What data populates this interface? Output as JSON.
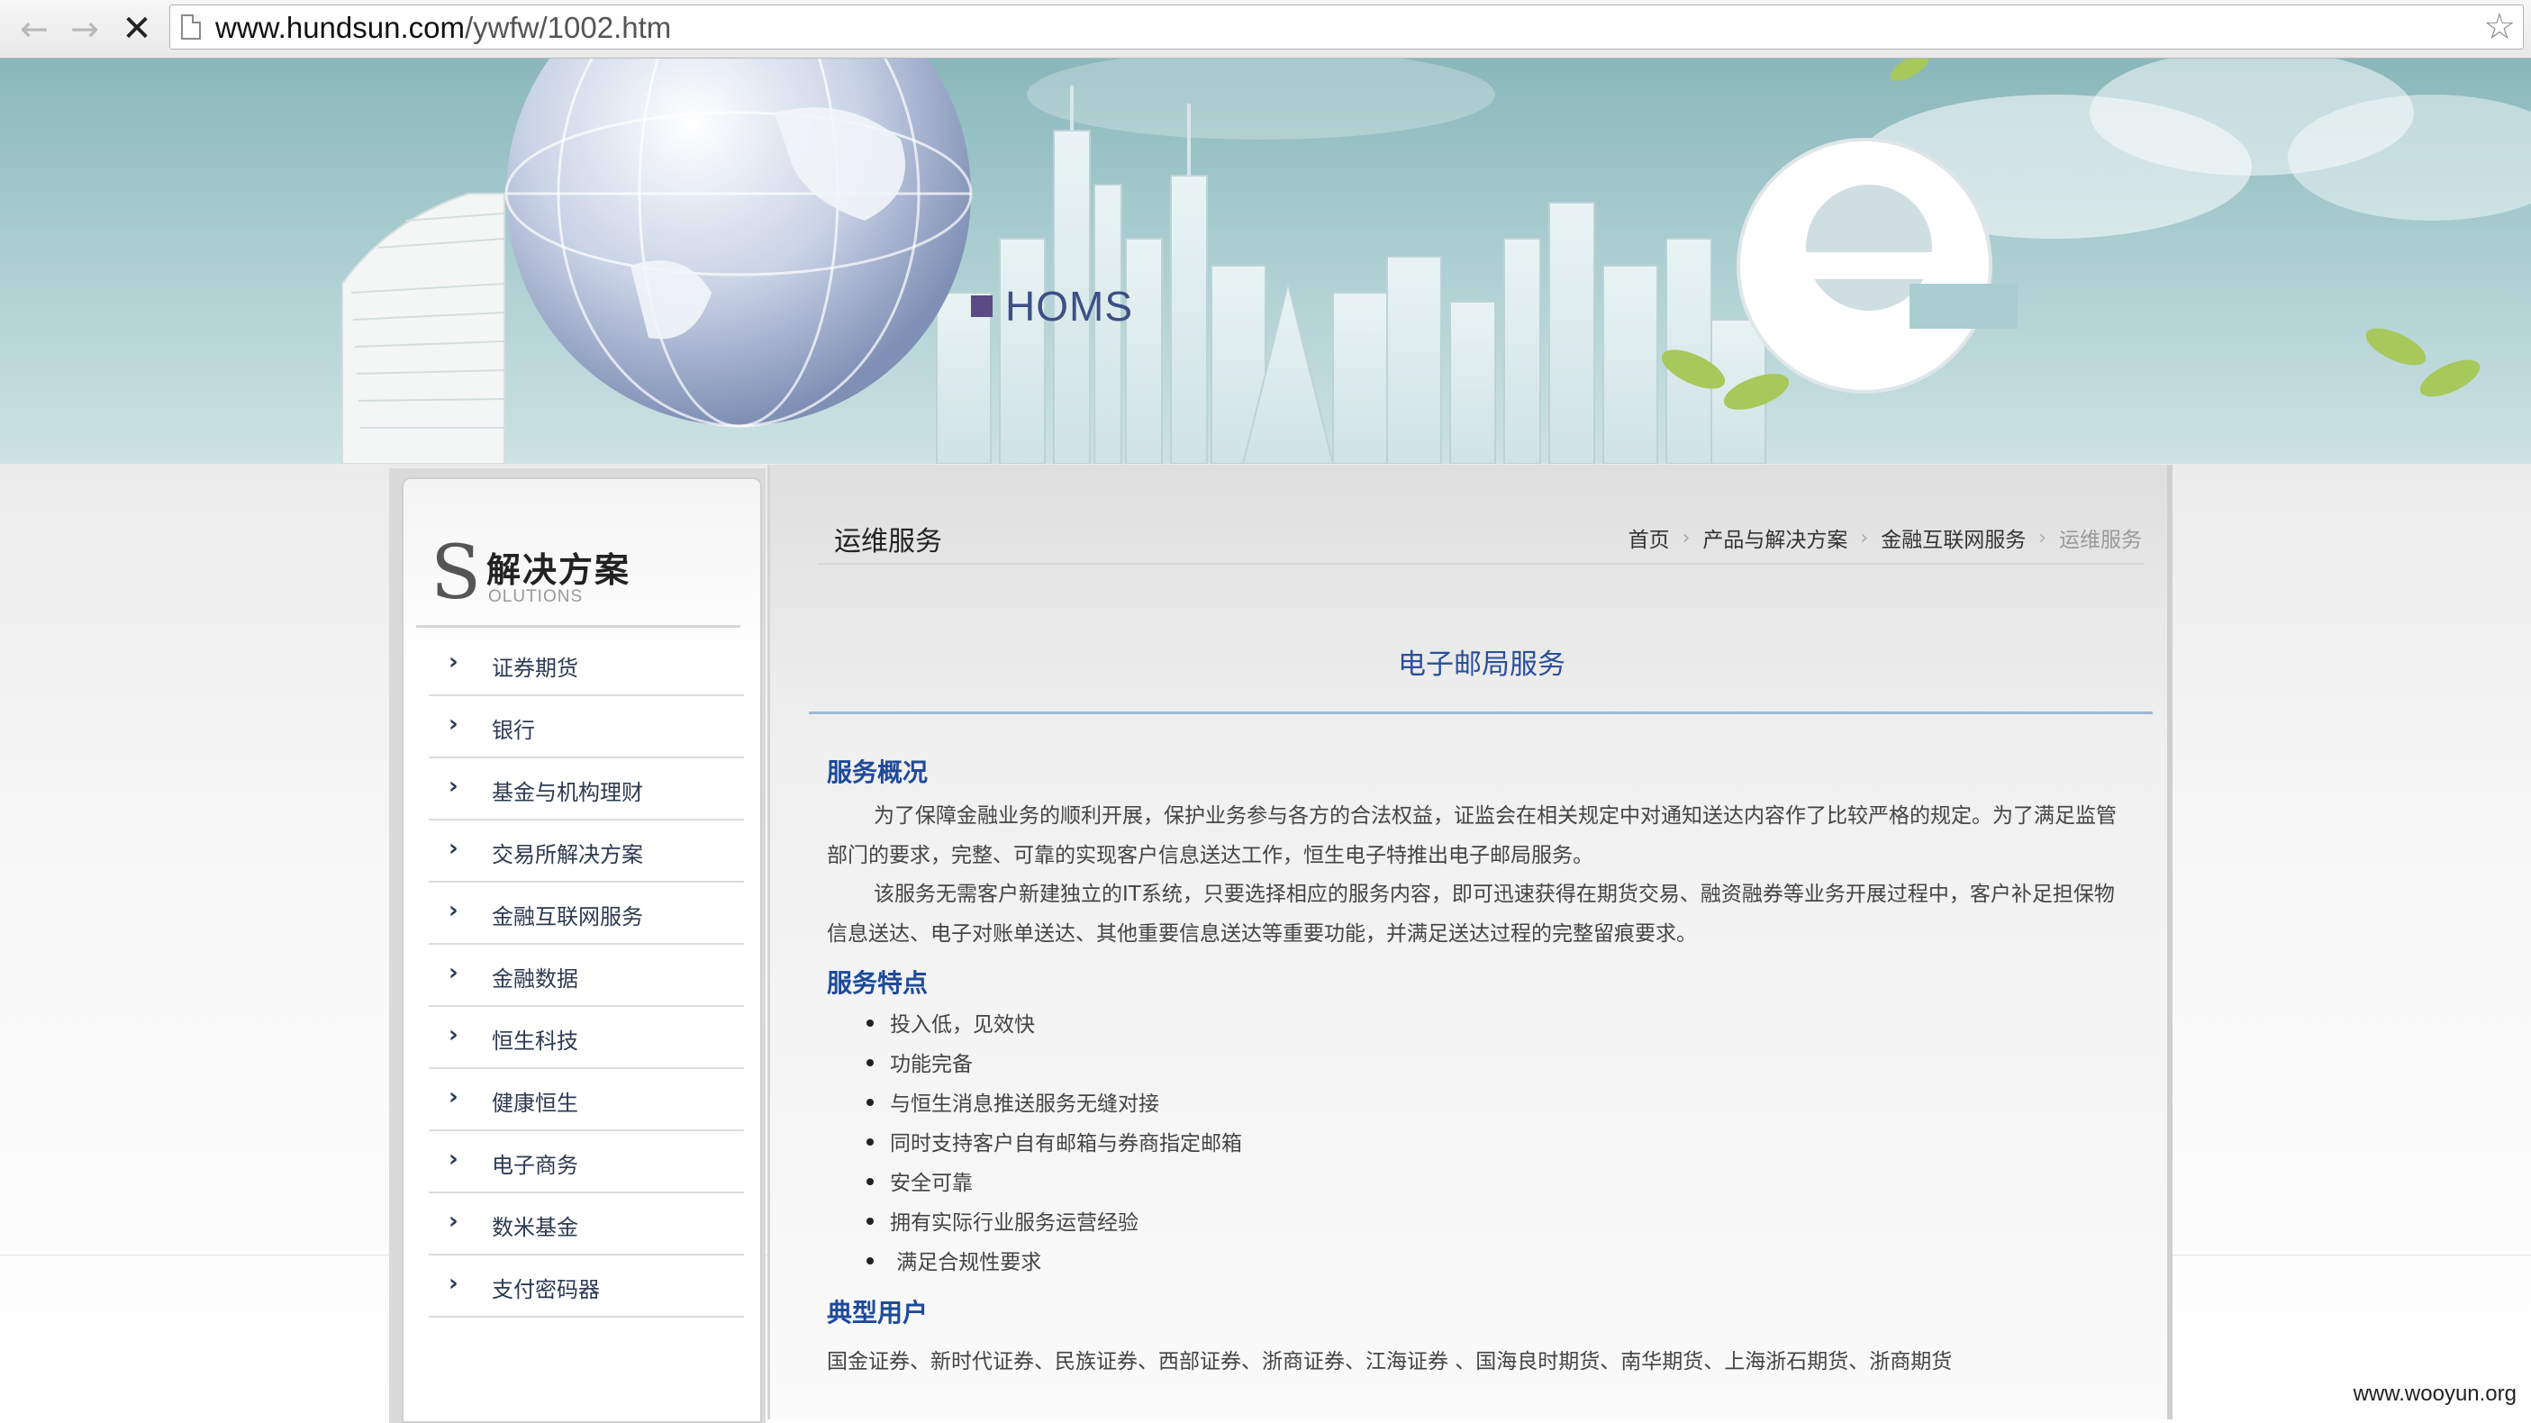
{
  "browser": {
    "url_host": "www.hundsun.com",
    "url_path": "/ywfw/1002.htm"
  },
  "banner": {
    "label": "HOMS"
  },
  "sidebar": {
    "title_letter": "S",
    "title": "解决方案",
    "subtitle": "OLUTIONS",
    "items": [
      {
        "label": "证券期货"
      },
      {
        "label": "银行"
      },
      {
        "label": "基金与机构理财"
      },
      {
        "label": "交易所解决方案"
      },
      {
        "label": "金融互联网服务"
      },
      {
        "label": "金融数据"
      },
      {
        "label": "恒生科技"
      },
      {
        "label": "健康恒生"
      },
      {
        "label": "电子商务"
      },
      {
        "label": "数米基金"
      },
      {
        "label": "支付密码器"
      }
    ]
  },
  "content": {
    "section_title": "运维服务",
    "breadcrumb": [
      "首页",
      "产品与解决方案",
      "金融互联网服务",
      "运维服务"
    ],
    "article_title": "电子邮局服务",
    "overview_heading": "服务概况",
    "overview_paragraphs": [
      "为了保障金融业务的顺利开展，保护业务参与各方的合法权益，证监会在相关规定中对通知送达内容作了比较严格的规定。为了满足监管部门的要求，完整、可靠的实现客户信息送达工作，恒生电子特推出电子邮局服务。",
      "该服务无需客户新建独立的IT系统，只要选择相应的服务内容，即可迅速获得在期货交易、融资融券等业务开展过程中，客户补足担保物信息送达、电子对账单送达、其他重要信息送达等重要功能，并满足送达过程的完整留痕要求。"
    ],
    "features_heading": "服务特点",
    "features": [
      "投入低，见效快",
      "功能完备",
      "与恒生消息推送服务无缝对接",
      "同时支持客户自有邮箱与券商指定邮箱",
      "安全可靠",
      "拥有实际行业服务运营经验",
      " 满足合规性要求"
    ],
    "users_heading": "典型用户",
    "users_text": "国金证券、新时代证券、民族证券、西部证券、浙商证券、江海证券 、国海良时期货、南华期货、上海浙石期货、浙商期货"
  },
  "watermark": "www.wooyun.org"
}
